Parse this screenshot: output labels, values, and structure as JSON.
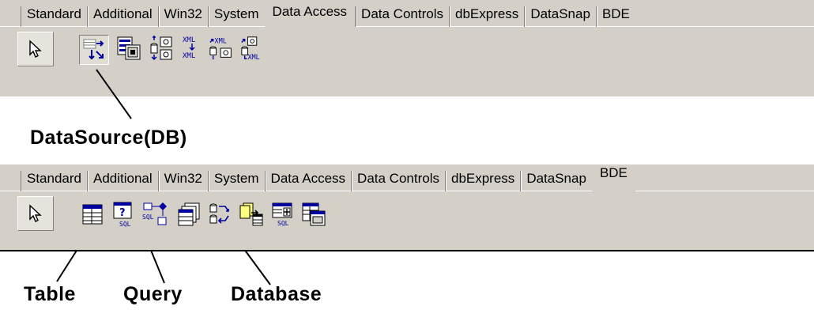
{
  "palette_top": {
    "tabs": [
      "Standard",
      "Additional",
      "Win32",
      "System",
      "Data Access",
      "Data Controls",
      "dbExpress",
      "DataSnap",
      "BDE"
    ],
    "active_tab": "Data Access",
    "components": [
      {
        "icon": "datasource-icon",
        "selected": true
      },
      {
        "icon": "clientdataset-icon"
      },
      {
        "icon": "dataset-provider-icon"
      },
      {
        "icon": "xml-transform-icon"
      },
      {
        "icon": "xml-transform-provider-icon"
      },
      {
        "icon": "xml-transform-client-icon"
      }
    ],
    "callout": "DataSource(DB)"
  },
  "palette_bottom": {
    "tabs": [
      "Standard",
      "Additional",
      "Win32",
      "System",
      "Data Access",
      "Data Controls",
      "dbExpress",
      "DataSnap",
      "BDE"
    ],
    "active_tab": "BDE",
    "components": [
      {
        "icon": "table-icon"
      },
      {
        "icon": "query-icon"
      },
      {
        "icon": "stored-proc-icon"
      },
      {
        "icon": "database-icon"
      },
      {
        "icon": "session-icon"
      },
      {
        "icon": "batch-move-icon"
      },
      {
        "icon": "update-sql-icon"
      },
      {
        "icon": "nested-table-icon"
      }
    ],
    "callouts": {
      "table": "Table",
      "query": "Query",
      "database": "Database"
    }
  },
  "colors": {
    "palette_bg": "#d4d0c8",
    "icon_blue": "#0000a0",
    "icon_grey": "#808080"
  }
}
